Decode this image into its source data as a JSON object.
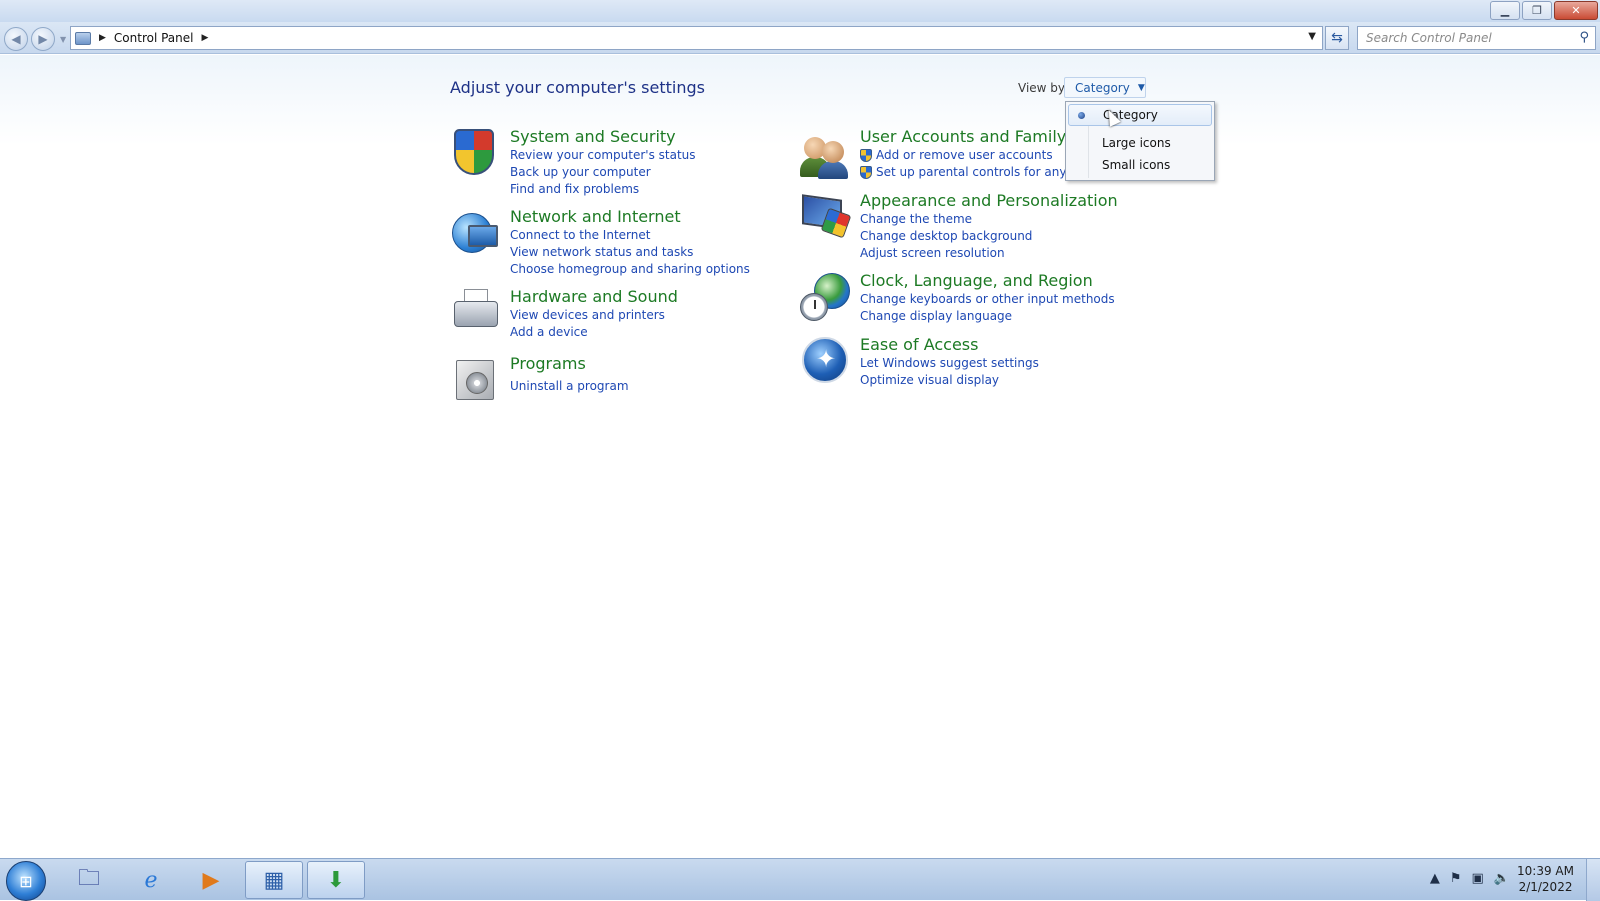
{
  "window": {
    "controls": {
      "minimize_icon": "minimize-icon",
      "restore_icon": "restore-icon",
      "close_icon": "close-icon"
    }
  },
  "nav": {
    "back_icon": "back-icon",
    "forward_icon": "forward-icon",
    "address": {
      "segments": [
        "Control Panel"
      ]
    },
    "search": {
      "placeholder": "Search Control Panel",
      "value": ""
    }
  },
  "main": {
    "title": "Adjust your computer's settings",
    "view_by": {
      "label": "View by:",
      "selected": "Category",
      "menu": {
        "items": [
          {
            "label": "Category",
            "selected": true
          },
          {
            "label": "Large icons",
            "selected": false
          },
          {
            "label": "Small icons",
            "selected": false
          }
        ]
      }
    },
    "left_categories": [
      {
        "title": "System and Security",
        "icon": "shield-icon",
        "links": [
          "Review your computer's status",
          "Back up your computer",
          "Find and fix problems"
        ]
      },
      {
        "title": "Network and Internet",
        "icon": "network-globe-icon",
        "links": [
          "Connect to the Internet",
          "View network status and tasks",
          "Choose homegroup and sharing options"
        ]
      },
      {
        "title": "Hardware and Sound",
        "icon": "printer-icon",
        "links": [
          "View devices and printers",
          "Add a device"
        ]
      },
      {
        "title": "Programs",
        "icon": "programs-box-icon",
        "links": [
          "Uninstall a program"
        ]
      }
    ],
    "right_categories": [
      {
        "title": "User Accounts and Family Saf",
        "icon": "users-icon",
        "links": [
          "Add or remove user accounts",
          "Set up parental controls for any use"
        ]
      },
      {
        "title": "Appearance and Personalization",
        "icon": "appearance-icon",
        "links": [
          "Change the theme",
          "Change desktop background",
          "Adjust screen resolution"
        ]
      },
      {
        "title": "Clock, Language, and Region",
        "icon": "clock-globe-icon",
        "links": [
          "Change keyboards or other input methods",
          "Change display language"
        ]
      },
      {
        "title": "Ease of Access",
        "icon": "ease-of-access-icon",
        "links": [
          "Let Windows suggest settings",
          "Optimize visual display"
        ]
      }
    ]
  },
  "taskbar": {
    "apps": [
      {
        "name": "file-explorer-icon",
        "active": false
      },
      {
        "name": "internet-explorer-icon",
        "active": false
      },
      {
        "name": "media-player-icon",
        "active": false
      },
      {
        "name": "control-panel-icon",
        "active": true
      },
      {
        "name": "download-app-icon",
        "active": true
      }
    ],
    "clock": {
      "time": "10:39 AM",
      "date": "2/1/2022"
    }
  }
}
